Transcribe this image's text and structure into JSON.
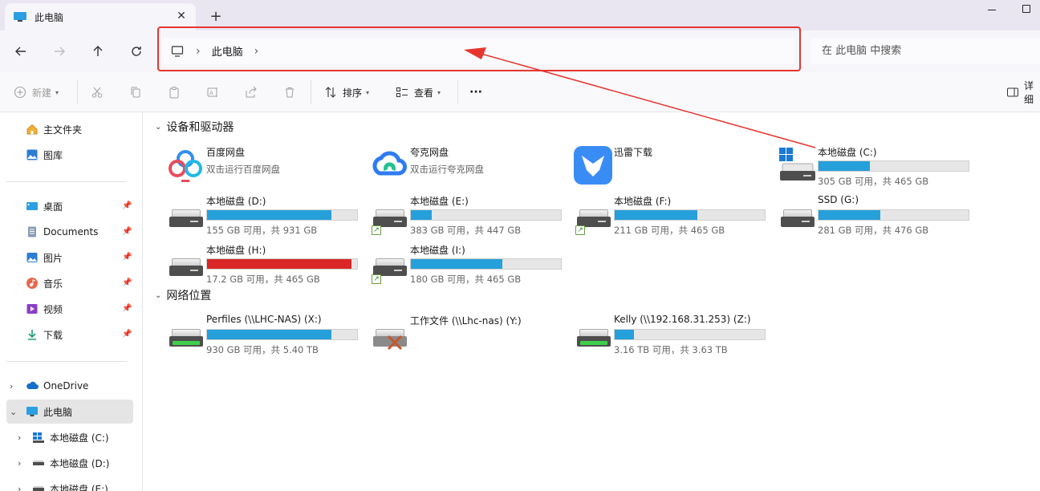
{
  "tab": {
    "title": "此电脑"
  },
  "navigation": {
    "breadcrumb": [
      "此电脑"
    ],
    "search_placeholder": "在 此电脑 中搜索"
  },
  "toolbar": {
    "new": "新建",
    "sort": "排序",
    "view": "查看",
    "more": "···",
    "details": "详细"
  },
  "sidebar": {
    "home": "主文件夹",
    "gallery": "图库",
    "desktop": "桌面",
    "documents": "Documents",
    "pictures": "图片",
    "music": "音乐",
    "videos": "视频",
    "downloads": "下载",
    "onedrive": "OneDrive",
    "this_pc": "此电脑",
    "drive_c": "本地磁盘 (C:)",
    "drive_d": "本地磁盘 (D:)",
    "drive_e": "本地磁盘 (E:)"
  },
  "devices": {
    "header": "设备和驱动器",
    "apps": [
      {
        "name": "百度网盘",
        "desc": "双击运行百度网盘"
      },
      {
        "name": "夸克网盘",
        "desc": "双击运行夸克网盘"
      },
      {
        "name": "迅雷下载",
        "desc": ""
      }
    ],
    "drives": [
      {
        "name": "本地磁盘 (C:)",
        "info": "305 GB 可用，共 465 GB",
        "used_fraction": 0.34
      },
      {
        "name": "本地磁盘 (D:)",
        "info": "155 GB 可用，共 931 GB",
        "used_fraction": 0.83
      },
      {
        "name": "本地磁盘 (E:)",
        "info": "383 GB 可用，共 447 GB",
        "used_fraction": 0.14
      },
      {
        "name": "本地磁盘 (F:)",
        "info": "211 GB 可用，共 465 GB",
        "used_fraction": 0.55
      },
      {
        "name": "SSD (G:)",
        "info": "281 GB 可用，共 476 GB",
        "used_fraction": 0.41
      },
      {
        "name": "本地磁盘 (H:)",
        "info": "17.2 GB 可用，共 465 GB",
        "used_fraction": 0.96
      },
      {
        "name": "本地磁盘 (I:)",
        "info": "180 GB 可用，共 465 GB",
        "used_fraction": 0.61
      }
    ]
  },
  "network": {
    "header": "网络位置",
    "drives": [
      {
        "name": "Perfiles (\\\\LHC-NAS) (X:)",
        "info": "930 GB 可用，共 5.40 TB",
        "used_fraction": 0.83
      },
      {
        "name": "工作文件 (\\\\Lhc-nas) (Y:)",
        "info": ""
      },
      {
        "name": "Kelly (\\\\192.168.31.253) (Z:)",
        "info": "3.16 TB 可用，共 3.63 TB",
        "used_fraction": 0.13
      }
    ]
  },
  "colors": {
    "bar_normal": "#26a0da",
    "bar_full": "#da2626",
    "annotation": "#e6352f"
  }
}
